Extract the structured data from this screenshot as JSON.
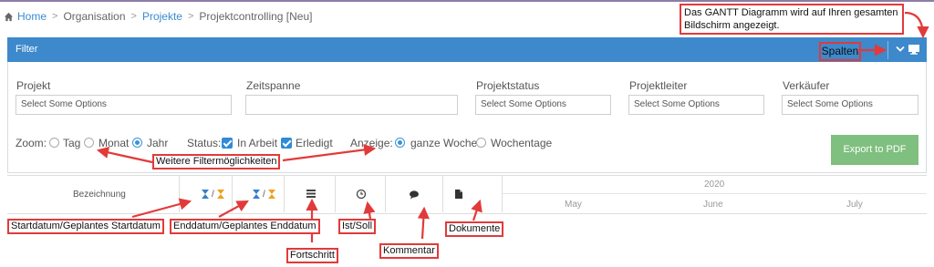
{
  "breadcrumb": {
    "home": "Home",
    "organisation": "Organisation",
    "projekte": "Projekte",
    "current": "Projektcontrolling [Neu]"
  },
  "panel": {
    "title": "Filter",
    "columns_button": "Spalten"
  },
  "filters": {
    "projekt": {
      "label": "Projekt",
      "placeholder": "Select Some Options"
    },
    "zeitspanne": {
      "label": "Zeitspanne",
      "value": ""
    },
    "projektstatus": {
      "label": "Projektstatus",
      "placeholder": "Select Some Options"
    },
    "projektleiter": {
      "label": "Projektleiter",
      "placeholder": "Select Some Options"
    },
    "verkaeufer": {
      "label": "Verkäufer",
      "placeholder": "Select Some Options"
    }
  },
  "zoom": {
    "label": "Zoom:",
    "options": [
      "Tag",
      "Monat",
      "Jahr"
    ],
    "selected": "Jahr"
  },
  "status": {
    "label": "Status:",
    "options": [
      "In Arbeit",
      "Erledigt"
    ],
    "checked": [
      "In Arbeit",
      "Erledigt"
    ]
  },
  "anzeige": {
    "label": "Anzeige:",
    "options": [
      "ganze Woche",
      "Wochentage"
    ],
    "selected": "ganze Woche"
  },
  "export_button": "Export to PDF",
  "gantt_header": {
    "bezeichnung": "Bezeichnung",
    "date_separator": "/",
    "year": "2020",
    "months": [
      "May",
      "June",
      "July"
    ]
  },
  "annotations": {
    "fullscreen": "Das GANTT Diagramm wird auf Ihren gesamten Bildschirm angezeigt.",
    "filters": "Weitere Filtermöglichkeiten",
    "start": "Startdatum/Geplantes Startdatum",
    "end": "Enddatum/Geplantes Enddatum",
    "progress": "Fortschritt",
    "ist_soll": "Ist/Soll",
    "comment": "Kommentar",
    "documents": "Dokumente"
  },
  "colors": {
    "header_blue": "#3d89cc",
    "link": "#3a8ccc",
    "export_green": "#7fbf7f",
    "annotation_red": "#e23a3a"
  }
}
